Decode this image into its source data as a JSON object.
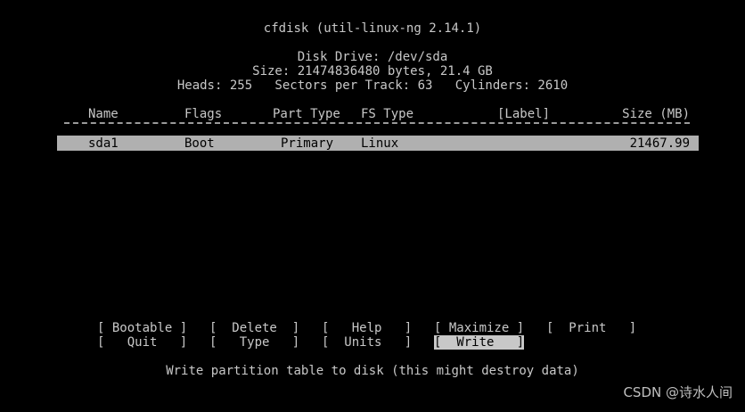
{
  "header": {
    "title": "cfdisk (util-linux-ng 2.14.1)",
    "disk_drive": "Disk Drive: /dev/sda",
    "size": "Size: 21474836480 bytes, 21.4 GB",
    "geometry": "Heads: 255   Sectors per Track: 63   Cylinders: 2610"
  },
  "table": {
    "columns": {
      "name": "Name",
      "flags": "Flags",
      "part_type": "Part Type",
      "fs_type": "FS Type",
      "label": "[Label]",
      "size": "Size (MB)"
    },
    "rows": [
      {
        "name": "sda1",
        "flags": "Boot",
        "part_type": "Primary",
        "fs_type": "Linux",
        "label": "",
        "size": "21467.99",
        "selected": true
      }
    ]
  },
  "menu": {
    "bootable": "[ Bootable ]",
    "delete": "[  Delete  ]",
    "help": "[   Help   ]",
    "maximize": "[ Maximize ]",
    "print": "[  Print   ]",
    "quit": "[   Quit   ]",
    "type": "[   Type   ]",
    "units": "[  Units   ]",
    "write": "[  Write   ]",
    "selected": "write"
  },
  "status": "Write partition table to disk (this might destroy data)",
  "watermark": "CSDN @诗水人间",
  "colors": {
    "background": "#000000",
    "text": "#c8c8c8",
    "highlight_background": "#b0b0b0",
    "highlight_text": "#000000"
  }
}
